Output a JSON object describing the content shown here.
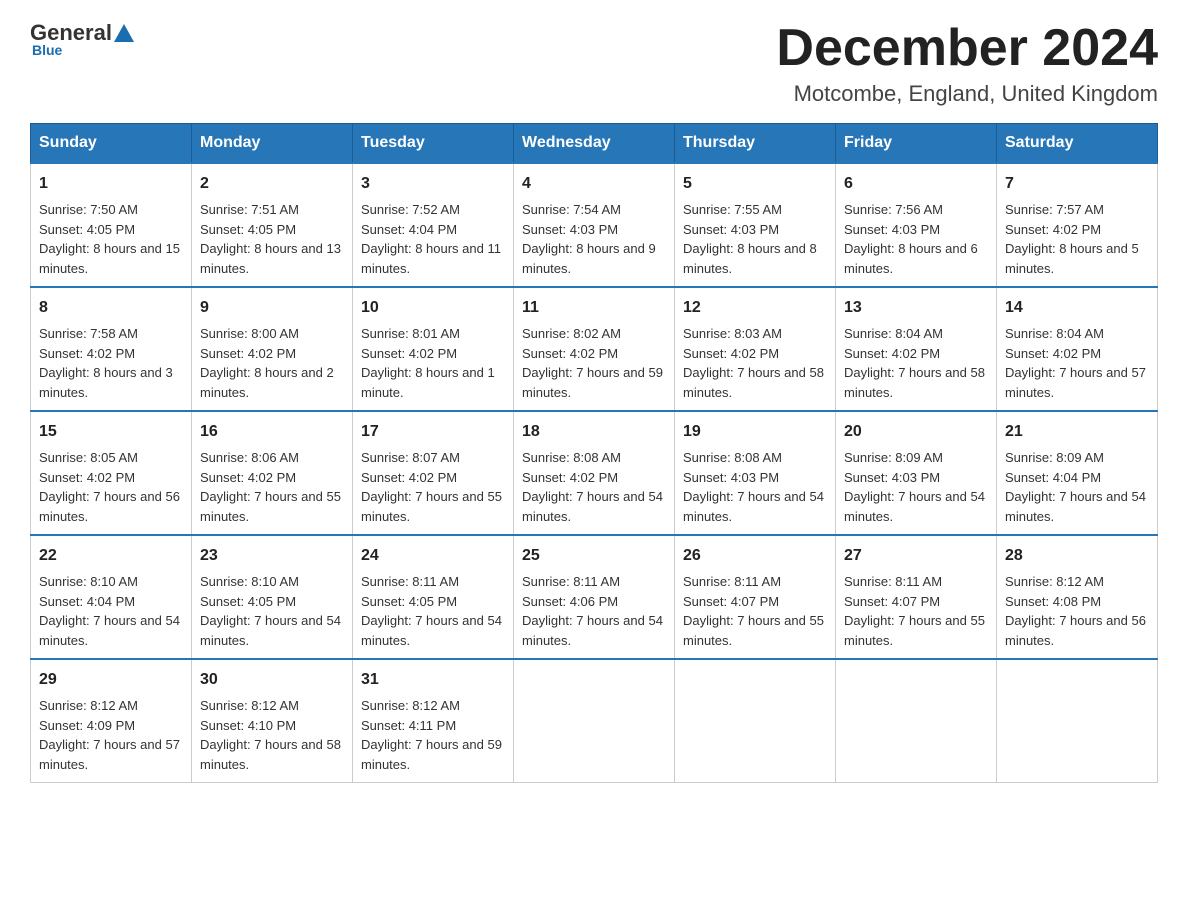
{
  "header": {
    "logo_general": "General",
    "logo_blue": "Blue",
    "month_title": "December 2024",
    "location": "Motcombe, England, United Kingdom"
  },
  "weekdays": [
    "Sunday",
    "Monday",
    "Tuesday",
    "Wednesday",
    "Thursday",
    "Friday",
    "Saturday"
  ],
  "weeks": [
    [
      {
        "day": "1",
        "sunrise": "7:50 AM",
        "sunset": "4:05 PM",
        "daylight": "8 hours and 15 minutes."
      },
      {
        "day": "2",
        "sunrise": "7:51 AM",
        "sunset": "4:05 PM",
        "daylight": "8 hours and 13 minutes."
      },
      {
        "day": "3",
        "sunrise": "7:52 AM",
        "sunset": "4:04 PM",
        "daylight": "8 hours and 11 minutes."
      },
      {
        "day": "4",
        "sunrise": "7:54 AM",
        "sunset": "4:03 PM",
        "daylight": "8 hours and 9 minutes."
      },
      {
        "day": "5",
        "sunrise": "7:55 AM",
        "sunset": "4:03 PM",
        "daylight": "8 hours and 8 minutes."
      },
      {
        "day": "6",
        "sunrise": "7:56 AM",
        "sunset": "4:03 PM",
        "daylight": "8 hours and 6 minutes."
      },
      {
        "day": "7",
        "sunrise": "7:57 AM",
        "sunset": "4:02 PM",
        "daylight": "8 hours and 5 minutes."
      }
    ],
    [
      {
        "day": "8",
        "sunrise": "7:58 AM",
        "sunset": "4:02 PM",
        "daylight": "8 hours and 3 minutes."
      },
      {
        "day": "9",
        "sunrise": "8:00 AM",
        "sunset": "4:02 PM",
        "daylight": "8 hours and 2 minutes."
      },
      {
        "day": "10",
        "sunrise": "8:01 AM",
        "sunset": "4:02 PM",
        "daylight": "8 hours and 1 minute."
      },
      {
        "day": "11",
        "sunrise": "8:02 AM",
        "sunset": "4:02 PM",
        "daylight": "7 hours and 59 minutes."
      },
      {
        "day": "12",
        "sunrise": "8:03 AM",
        "sunset": "4:02 PM",
        "daylight": "7 hours and 58 minutes."
      },
      {
        "day": "13",
        "sunrise": "8:04 AM",
        "sunset": "4:02 PM",
        "daylight": "7 hours and 58 minutes."
      },
      {
        "day": "14",
        "sunrise": "8:04 AM",
        "sunset": "4:02 PM",
        "daylight": "7 hours and 57 minutes."
      }
    ],
    [
      {
        "day": "15",
        "sunrise": "8:05 AM",
        "sunset": "4:02 PM",
        "daylight": "7 hours and 56 minutes."
      },
      {
        "day": "16",
        "sunrise": "8:06 AM",
        "sunset": "4:02 PM",
        "daylight": "7 hours and 55 minutes."
      },
      {
        "day": "17",
        "sunrise": "8:07 AM",
        "sunset": "4:02 PM",
        "daylight": "7 hours and 55 minutes."
      },
      {
        "day": "18",
        "sunrise": "8:08 AM",
        "sunset": "4:02 PM",
        "daylight": "7 hours and 54 minutes."
      },
      {
        "day": "19",
        "sunrise": "8:08 AM",
        "sunset": "4:03 PM",
        "daylight": "7 hours and 54 minutes."
      },
      {
        "day": "20",
        "sunrise": "8:09 AM",
        "sunset": "4:03 PM",
        "daylight": "7 hours and 54 minutes."
      },
      {
        "day": "21",
        "sunrise": "8:09 AM",
        "sunset": "4:04 PM",
        "daylight": "7 hours and 54 minutes."
      }
    ],
    [
      {
        "day": "22",
        "sunrise": "8:10 AM",
        "sunset": "4:04 PM",
        "daylight": "7 hours and 54 minutes."
      },
      {
        "day": "23",
        "sunrise": "8:10 AM",
        "sunset": "4:05 PM",
        "daylight": "7 hours and 54 minutes."
      },
      {
        "day": "24",
        "sunrise": "8:11 AM",
        "sunset": "4:05 PM",
        "daylight": "7 hours and 54 minutes."
      },
      {
        "day": "25",
        "sunrise": "8:11 AM",
        "sunset": "4:06 PM",
        "daylight": "7 hours and 54 minutes."
      },
      {
        "day": "26",
        "sunrise": "8:11 AM",
        "sunset": "4:07 PM",
        "daylight": "7 hours and 55 minutes."
      },
      {
        "day": "27",
        "sunrise": "8:11 AM",
        "sunset": "4:07 PM",
        "daylight": "7 hours and 55 minutes."
      },
      {
        "day": "28",
        "sunrise": "8:12 AM",
        "sunset": "4:08 PM",
        "daylight": "7 hours and 56 minutes."
      }
    ],
    [
      {
        "day": "29",
        "sunrise": "8:12 AM",
        "sunset": "4:09 PM",
        "daylight": "7 hours and 57 minutes."
      },
      {
        "day": "30",
        "sunrise": "8:12 AM",
        "sunset": "4:10 PM",
        "daylight": "7 hours and 58 minutes."
      },
      {
        "day": "31",
        "sunrise": "8:12 AM",
        "sunset": "4:11 PM",
        "daylight": "7 hours and 59 minutes."
      },
      null,
      null,
      null,
      null
    ]
  ]
}
